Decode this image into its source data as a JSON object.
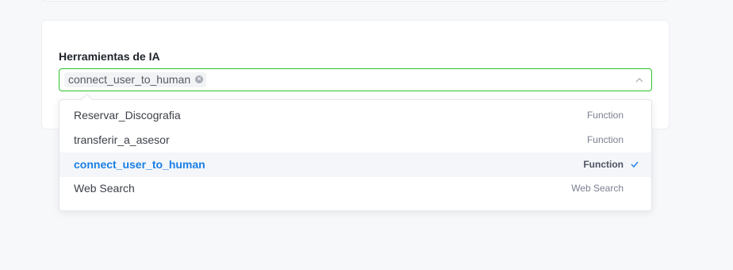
{
  "form": {
    "label": "Herramientas de IA",
    "selected_tags": [
      "connect_user_to_human"
    ]
  },
  "dropdown": {
    "options": [
      {
        "name": "Reservar_Discografia",
        "type": "Function",
        "selected": false
      },
      {
        "name": "transferir_a_asesor",
        "type": "Function",
        "selected": false
      },
      {
        "name": "connect_user_to_human",
        "type": "Function",
        "selected": true
      },
      {
        "name": "Web Search",
        "type": "Web Search",
        "selected": false
      }
    ]
  },
  "colors": {
    "focus_border": "#2ec52e",
    "selected_text": "#1a7fe6",
    "selected_bg": "#f4f6f9"
  },
  "icons": {
    "tag_close": "close-circle-icon",
    "select_toggle": "chevron-up-icon",
    "selected_mark": "check-icon"
  }
}
